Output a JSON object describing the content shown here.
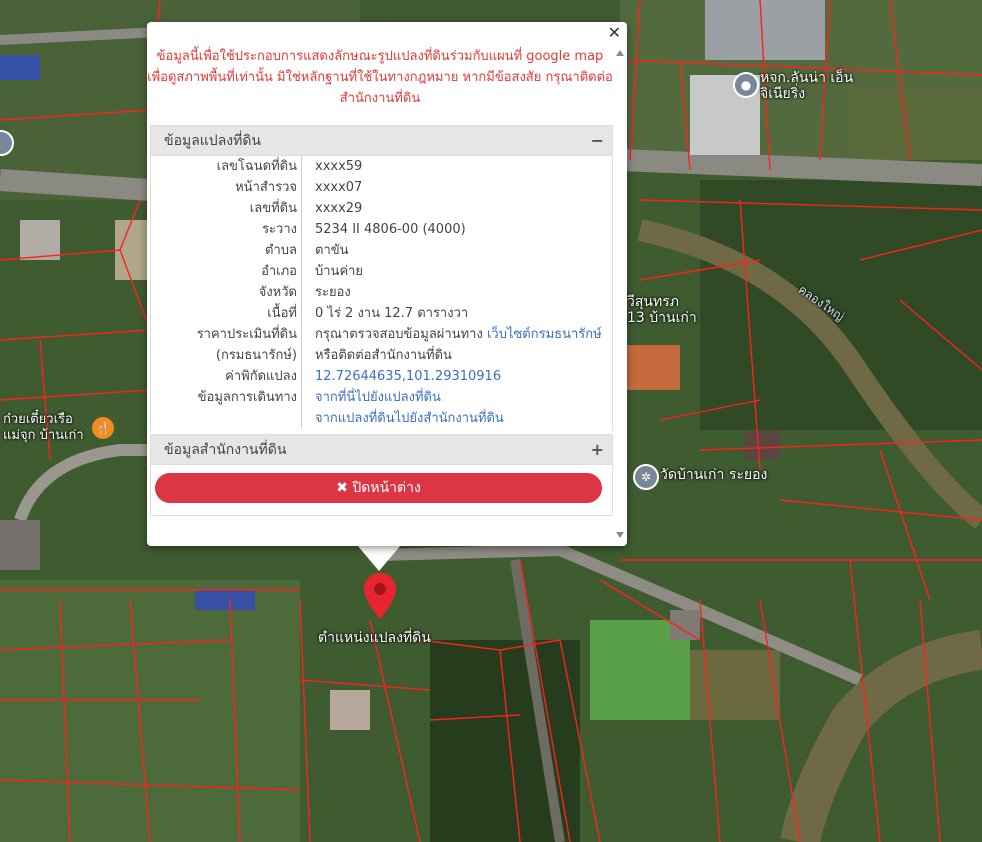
{
  "map": {
    "labels": {
      "top_right_place": "หจก.ลันน่า เอ็น\nจิเนียริ่ง",
      "temple_school": "วีสุนทรภ\n13 บ้านเก่า",
      "river": "คลองใหญ่",
      "noodle_shop": "ก๋วยเตี๋ยวเรือ\nแม่จุก บ้านเก่า",
      "temple": "วัดบ้านเก่า ระยอง"
    },
    "marker_label": "ตำแหน่งแปลงที่ดิน",
    "colors": {
      "parcel_line": "#ff2020",
      "marker": "#e8252e",
      "accent": "#dc3545",
      "link": "#3b6fc4",
      "notice": "#e53935"
    }
  },
  "popup": {
    "close_icon": "close-icon",
    "notice": "ข้อมูลนี้เพื่อใช้ประกอบการแสดงลักษณะรูปแปลงที่ดินร่วมกับแผนที่ google map เพื่อดูสภาพพื้นที่เท่านั้น มิใช่หลักฐานที่ใช้ในทางกฎหมาย หากมีข้อสงสัย กรุณาติดต่อสำนักงานที่ดิน",
    "parcel_panel": {
      "title": "ข้อมูลแปลงที่ดิน",
      "toggle": "−",
      "rows": [
        {
          "label": "เลขโฉนดที่ดิน",
          "value": "xxxx59"
        },
        {
          "label": "หน้าสำรวจ",
          "value": "xxxx07"
        },
        {
          "label": "เลขที่ดิน",
          "value": "xxxx29"
        },
        {
          "label": "ระวาง",
          "value": "5234 II 4806-00 (4000)"
        },
        {
          "label": "ตำบล",
          "value": "ตาขัน"
        },
        {
          "label": "อำเภอ",
          "value": "บ้านค่าย"
        },
        {
          "label": "จังหวัด",
          "value": "ระยอง"
        },
        {
          "label": "เนื้อที่",
          "value": "0 ไร่ 2 งาน 12.7 ตารางวา"
        }
      ],
      "price_label_1": "ราคาประเมินที่ดิน",
      "price_value_1": "กรุณาตรวจสอบข้อมูลผ่านทาง",
      "price_link": "เว็บไซต์กรมธนารักษ์",
      "price_label_2": "(กรมธนารักษ์)",
      "price_value_2": "หรือติดต่อสำนักงานที่ดิน",
      "coord_label": "ค่าพิกัดแปลง",
      "coord_value": "12.72644635,101.29310916",
      "travel_label": "ข้อมูลการเดินทาง",
      "travel_link_1": "จากที่นี่ไปยังแปลงที่ดิน",
      "travel_link_2": "จากแปลงที่ดินไปยังสำนักงานที่ดิน"
    },
    "office_panel": {
      "title": "ข้อมูลสำนักงานที่ดิน",
      "toggle": "+"
    },
    "close_button": {
      "icon": "✖",
      "label": "ปิดหน้าต่าง"
    }
  }
}
